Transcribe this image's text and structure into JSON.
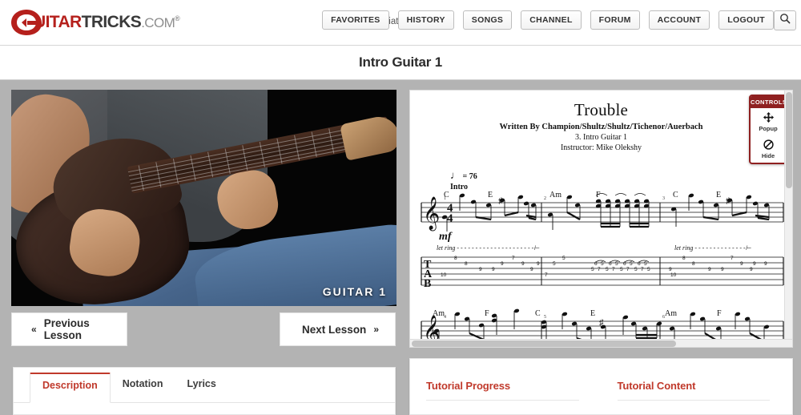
{
  "header": {
    "logo": {
      "prefix": "G",
      "word1": "UITAR",
      "word2": "TRICKS",
      "suffix": ".COM",
      "registered": "®"
    },
    "greeting": "Hello affiliate!",
    "nav": [
      {
        "label": "FAVORITES",
        "name": "favorites"
      },
      {
        "label": "HISTORY",
        "name": "history"
      },
      {
        "label": "SONGS",
        "name": "songs"
      },
      {
        "label": "CHANNEL",
        "name": "channel"
      },
      {
        "label": "FORUM",
        "name": "forum"
      },
      {
        "label": "ACCOUNT",
        "name": "account"
      },
      {
        "label": "LOGOUT",
        "name": "logout"
      }
    ],
    "search_icon": "search-icon"
  },
  "page_title": "Intro Guitar 1",
  "video": {
    "overlay_label": "GUITAR 1",
    "prev_label": "Previous Lesson",
    "next_label": "Next Lesson",
    "prev_chevron": "«",
    "next_chevron": "»"
  },
  "tabs": [
    {
      "label": "Description",
      "active": true
    },
    {
      "label": "Notation",
      "active": false
    },
    {
      "label": "Lyrics",
      "active": false
    }
  ],
  "sheet": {
    "title": "Trouble",
    "credit": "Written By Champion/Shultz/Shultz/Tichenor/Auerbach",
    "track": "3. Intro Guitar 1",
    "instructor": "Instructor: Mike Olekshy",
    "tempo_note": "♩",
    "tempo": "= 76",
    "section": "Intro",
    "dynamic": "mf",
    "time_signature": "4/4",
    "clef": "treble",
    "let_ring_1": "let ring",
    "let_ring_2": "let ring",
    "measure_numbers": [
      "1",
      "2",
      "3",
      "4",
      "5",
      "6"
    ],
    "chords_system1": [
      "C",
      "E",
      "Am",
      "F",
      "C",
      "E"
    ],
    "chords_system2": [
      "Am",
      "F",
      "C",
      "E",
      "Am",
      "F"
    ],
    "tab_labels": [
      "T",
      "A",
      "B"
    ],
    "tab_numbers_m1": [
      "8",
      "8",
      "9",
      "9",
      "10",
      "9",
      "7",
      "9",
      "9",
      "9"
    ],
    "tab_numbers_m2": [
      "5",
      "5",
      "7",
      "6",
      "5",
      "6",
      "5",
      "6",
      "5",
      "6",
      "5",
      "7",
      "5",
      "7",
      "5",
      "7",
      "5",
      "7",
      "5"
    ],
    "tab_numbers_m3": [
      "8",
      "9",
      "10",
      "8",
      "9",
      "9",
      "7",
      "9",
      "9",
      "9"
    ]
  },
  "controls": {
    "header": "CONTROLS",
    "items": [
      {
        "label": "Popup",
        "icon": "move-arrows-icon"
      },
      {
        "label": "Hide",
        "icon": "no-entry-icon"
      }
    ]
  },
  "right_panel": {
    "progress_title": "Tutorial Progress",
    "content_title": "Tutorial Content"
  },
  "colors": {
    "brand_red": "#b5201c",
    "accent_red": "#c0392b",
    "controls_red": "#8f2020",
    "stage_gray": "#b3b3b3"
  }
}
